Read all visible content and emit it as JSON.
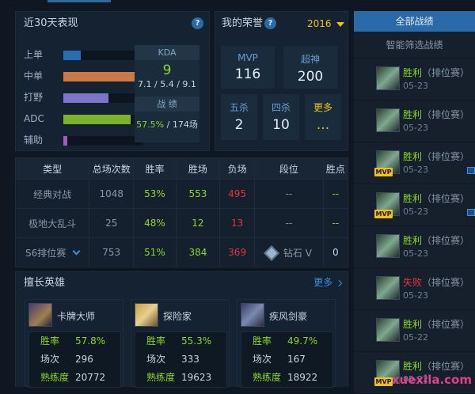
{
  "performance": {
    "title": "近30天表现",
    "help": "?",
    "lanes": [
      {
        "name": "上单",
        "fill": 0.22,
        "color": "#2a6cb0"
      },
      {
        "name": "中单",
        "fill": 1.0,
        "color": "#cc7a45"
      },
      {
        "name": "打野",
        "fill": 0.56,
        "color": "#7d76c8"
      },
      {
        "name": "ADC",
        "fill": 0.84,
        "color": "#7bb32b"
      },
      {
        "name": "辅助",
        "fill": 0.05,
        "color": "#a45ab8"
      }
    ],
    "kda_label": "KDA",
    "kda_value": "9",
    "kda_detail": "7.1 / 5.4 / 9.1",
    "record_label": "战 绩",
    "win_rate": "57.5%",
    "games": "174场"
  },
  "honor": {
    "title": "我的荣誉",
    "help": "?",
    "year": "2016",
    "mvp_label": "MVP",
    "mvp_value": "116",
    "legendary_label": "超神",
    "legendary_value": "200",
    "penta_label": "五杀",
    "penta_value": "2",
    "quadra_label": "四杀",
    "quadra_value": "10",
    "more_label": "更多",
    "more_value": "..."
  },
  "stats_table": {
    "headers": [
      "类型",
      "总场次数",
      "胜率",
      "胜场",
      "负场",
      "段位",
      "胜点"
    ],
    "rows": [
      {
        "type": "经典对战",
        "total": "1048",
        "rate": "53%",
        "wins": "553",
        "losses": "495",
        "rank": "--",
        "points": "--"
      },
      {
        "type": "极地大乱斗",
        "total": "25",
        "rate": "48%",
        "wins": "12",
        "losses": "13",
        "rank": "--",
        "points": "--"
      },
      {
        "type": "S6排位赛",
        "total": "753",
        "rate": "51%",
        "wins": "384",
        "losses": "369",
        "rank": "钻石 V",
        "points": "0"
      }
    ]
  },
  "heroes": {
    "title": "擅长英雄",
    "more": "更多",
    "items": [
      {
        "name": "卡牌大师",
        "rate_label": "胜率",
        "rate": "57.8%",
        "games_label": "场次",
        "games": "296",
        "prof_label": "熟练度",
        "prof": "20772"
      },
      {
        "name": "探险家",
        "rate_label": "胜率",
        "rate": "55.3%",
        "games_label": "场次",
        "games": "333",
        "prof_label": "熟练度",
        "prof": "19623"
      },
      {
        "name": "疾风剑豪",
        "rate_label": "胜率",
        "rate": "49.7%",
        "games_label": "场次",
        "games": "167",
        "prof_label": "熟练度",
        "prof": "18922"
      }
    ]
  },
  "matches": {
    "all_tab": "全部战绩",
    "filter_tab": "智能筛选战绩",
    "items": [
      {
        "result": "胜利",
        "mode": "（排位赛）",
        "date": "05-23",
        "mvp": false,
        "win": true
      },
      {
        "result": "胜利",
        "mode": "（排位赛）",
        "date": "05-23",
        "mvp": false,
        "win": true
      },
      {
        "result": "胜利",
        "mode": "（排位赛）",
        "date": "05-23",
        "mvp": true,
        "win": true
      },
      {
        "result": "胜利",
        "mode": "（排位赛）",
        "date": "05-23",
        "mvp": true,
        "win": true
      },
      {
        "result": "胜利",
        "mode": "（排位赛）",
        "date": "05-23",
        "mvp": false,
        "win": true
      },
      {
        "result": "失败",
        "mode": "（排位赛）",
        "date": "05-23",
        "mvp": false,
        "win": false
      },
      {
        "result": "胜利",
        "mode": "（排位赛）",
        "date": "05-22",
        "mvp": false,
        "win": true
      },
      {
        "result": "胜利",
        "mode": "（排位赛）",
        "date": "05-22",
        "mvp": true,
        "win": true
      }
    ],
    "mvp_badge": "MVP"
  },
  "watermark": "xuexila.com"
}
